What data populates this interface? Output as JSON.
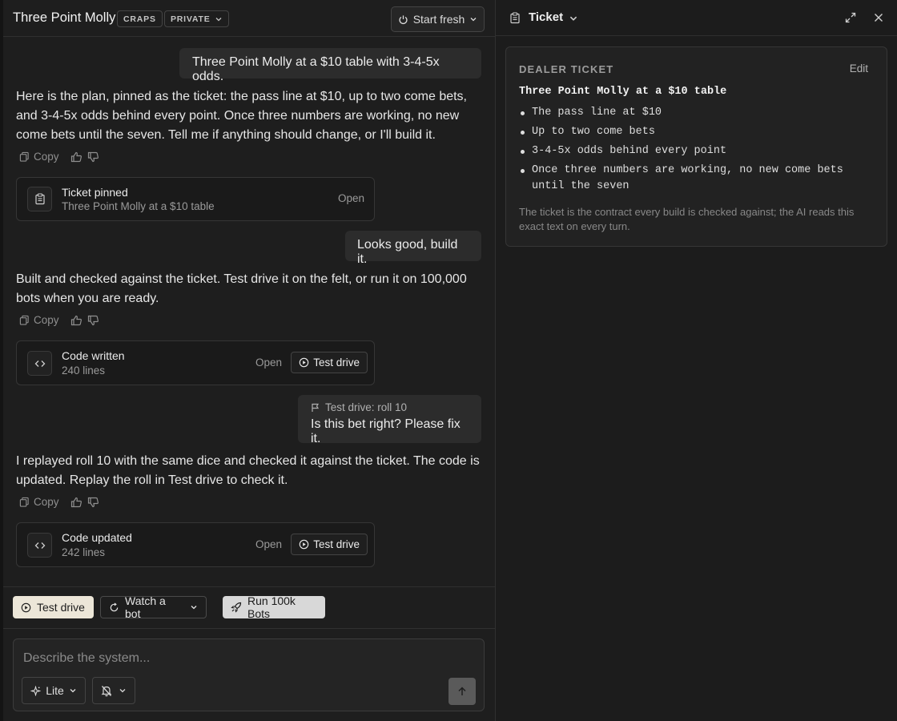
{
  "header": {
    "title": "Three Point Molly",
    "tag_game": "CRAPS",
    "tag_visibility": "PRIVATE",
    "start_fresh": "Start fresh"
  },
  "messages": {
    "user1": "Three Point Molly at a $10 table with 3-4-5x odds.",
    "assistant1": "Here is the plan, pinned as the ticket: the pass line at $10, up to two come bets, and 3-4-5x odds behind every point. Once three numbers are working, no new come bets until the seven. Tell me if anything should change, or I'll build it.",
    "card1": {
      "title": "Ticket pinned",
      "sub": "Three Point Molly at a $10 table",
      "open": "Open"
    },
    "user2": "Looks good, build it.",
    "assistant2": "Built and checked against the ticket. Test drive it on the felt, or run it on 100,000 bots when you are ready.",
    "card2": {
      "title": "Code written",
      "sub": "240 lines",
      "open": "Open",
      "test": "Test drive"
    },
    "user3_tag": "Test drive: roll 10",
    "user3": "Is this bet right? Please fix it.",
    "assistant3": "I replayed roll 10 with the same dice and checked it against the ticket. The code is updated. Replay the roll in Test drive to check it.",
    "card3": {
      "title": "Code updated",
      "sub": "242 lines",
      "open": "Open",
      "test": "Test drive"
    },
    "copy": "Copy"
  },
  "toolbar": {
    "test_drive": "Test drive",
    "watch_bot": "Watch a bot",
    "run_bots": "Run 100k Bots"
  },
  "composer": {
    "placeholder": "Describe the system...",
    "model": "Lite"
  },
  "panel": {
    "title": "Ticket",
    "label": "DEALER TICKET",
    "edit": "Edit",
    "heading": "Three Point Molly at a $10 table",
    "items": [
      "The pass line at $10",
      "Up to two come bets",
      "3-4-5x odds behind every point",
      "Once three numbers are working, no new come bets until the seven"
    ],
    "note": "The ticket is the contract every build is checked against; the AI reads this exact text on every turn."
  },
  "colors": {
    "background": "#1e1e1e",
    "bubble": "#2c2c2c",
    "primary_button": "#ece6d8",
    "run_button": "#d8d8d8"
  }
}
